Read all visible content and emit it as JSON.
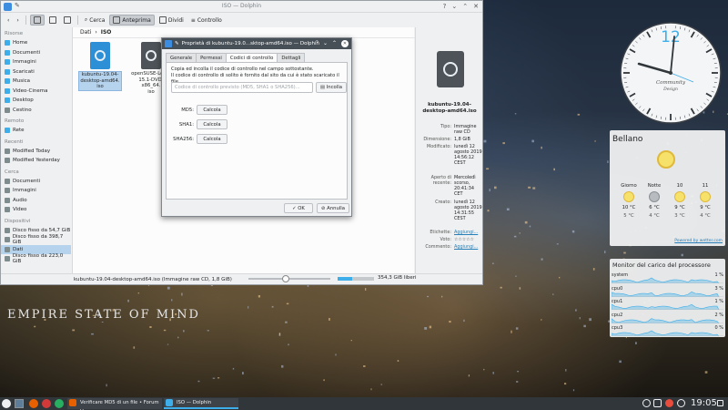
{
  "colors": {
    "accent": "#3daee9",
    "selection": "#b6d3ee",
    "panel": "#31363b",
    "window": "#eff0f1",
    "dialog_title": "#475057"
  },
  "wallpaper": {
    "text": "EMPIRE STATE OF MIND"
  },
  "dolphin": {
    "window_title": "ISO — Dolphin",
    "toolbar": {
      "search": "Cerca",
      "preview": "Anteprima",
      "split": "Dividi",
      "control": "Controllo"
    },
    "places": {
      "sections": [
        {
          "title": "Risorse",
          "items": [
            {
              "label": "Home",
              "icon": "home-icon",
              "color": "#3daee9"
            },
            {
              "label": "Documenti",
              "icon": "folder-documents-icon",
              "color": "#3daee9"
            },
            {
              "label": "Immagini",
              "icon": "folder-pictures-icon",
              "color": "#3daee9"
            },
            {
              "label": "Scaricati",
              "icon": "folder-download-icon",
              "color": "#3daee9"
            },
            {
              "label": "Musica",
              "icon": "folder-music-icon",
              "color": "#3daee9"
            },
            {
              "label": "Video-Cinema",
              "icon": "folder-videos-icon",
              "color": "#3daee9"
            },
            {
              "label": "Desktop",
              "icon": "desktop-icon",
              "color": "#3daee9"
            },
            {
              "label": "Cestino",
              "icon": "trash-icon",
              "color": "#7f8c8d"
            }
          ]
        },
        {
          "title": "Remoto",
          "items": [
            {
              "label": "Rete",
              "icon": "network-icon",
              "color": "#3daee9"
            }
          ]
        },
        {
          "title": "Recenti",
          "items": [
            {
              "label": "Modified Today",
              "icon": "calendar-icon",
              "color": "#7f8c8d"
            },
            {
              "label": "Modified Yesterday",
              "icon": "calendar-icon",
              "color": "#7f8c8d"
            }
          ]
        },
        {
          "title": "Cerca",
          "items": [
            {
              "label": "Documenti",
              "icon": "search-documents-icon",
              "color": "#7f8c8d"
            },
            {
              "label": "Immagini",
              "icon": "search-images-icon",
              "color": "#7f8c8d"
            },
            {
              "label": "Audio",
              "icon": "search-audio-icon",
              "color": "#7f8c8d"
            },
            {
              "label": "Video",
              "icon": "search-video-icon",
              "color": "#7f8c8d"
            }
          ]
        },
        {
          "title": "Dispositivi",
          "items": [
            {
              "label": "Disco fisso da 54,7 GiB",
              "icon": "drive-icon",
              "color": "#7f8c8d"
            },
            {
              "label": "Disco fisso da 398,7 GiB",
              "icon": "drive-icon",
              "color": "#7f8c8d"
            },
            {
              "label": "Dati",
              "icon": "drive-icon",
              "color": "#7f8c8d",
              "selected": true
            },
            {
              "label": "Disco fisso da 223,0 GiB",
              "icon": "drive-icon",
              "color": "#7f8c8d"
            }
          ]
        }
      ]
    },
    "breadcrumb": {
      "parent": "Dati",
      "separator": "›",
      "current": "ISO"
    },
    "files": [
      {
        "name": "kubuntu-19.04-desktop-amd64.iso",
        "lines": [
          "kubuntu-19.04-",
          "desktop-amd64.",
          "iso"
        ],
        "color": "#2d8fd5",
        "selected": true
      },
      {
        "name": "openSUSE-Leap-15.1-DVD-x86_64.iso",
        "lines": [
          "openSUSE-Leap-",
          "15.1-DVD-x86_64.",
          "iso"
        ],
        "color": "#4d5358",
        "selected": false
      }
    ],
    "info": {
      "name": "kubuntu-19.04-desktop-amd64.iso",
      "rows": [
        {
          "k": "Tipo:",
          "v": "Immagine raw CD"
        },
        {
          "k": "Dimensione:",
          "v": "1,8 GiB"
        },
        {
          "k": "Modificato:",
          "v": "lunedì 12 agosto 2019 14:56:12 CEST"
        },
        {
          "k": "Aperto di recente:",
          "v": "Mercoledì scorso, 20:41:34 CET"
        },
        {
          "k": "Creato:",
          "v": "lunedì 12 agosto 2019 14:31:55 CEST"
        },
        {
          "k": "Etichette:",
          "v": "Aggiungi...",
          "link": true
        },
        {
          "k": "Voto:",
          "v": "☆☆☆☆☆"
        },
        {
          "k": "Commento:",
          "v": "Aggiungi...",
          "link": true
        }
      ]
    },
    "status_text": "kubuntu-19.04-desktop-amd64.iso (Immagine raw CD, 1,8 GiB)",
    "free_space": "354,3 GiB liberi",
    "free_space_used_fraction": 0.4,
    "zoom_level": 0.45
  },
  "dialog": {
    "title": "Proprietà di kubuntu-19.0...sktop-amd64.iso — Dolphin",
    "tabs": [
      "Generale",
      "Permessi",
      "Codici di controllo",
      "Dettagli"
    ],
    "active_tab": 2,
    "description_1": "Copia ed incolla il codice di controllo nel campo sottostante.",
    "description_2": "Il codice di controllo di solito è fornito dal sito da cui è stato scaricato il file.",
    "input_placeholder": "Codice di controllo previsto (MD5, SHA1 o SHA256)...",
    "paste_label": "Incolla",
    "hashes": [
      {
        "label": "MD5:",
        "button": "Calcola"
      },
      {
        "label": "SHA1:",
        "button": "Calcola"
      },
      {
        "label": "SHA256:",
        "button": "Calcola"
      }
    ],
    "ok_label": "OK",
    "cancel_label": "Annulla"
  },
  "clock_widget": {
    "number": "12",
    "brand_1": "Community",
    "brand_2": "Design"
  },
  "weather": {
    "city": "Bellano",
    "days": [
      {
        "name": "Giorno",
        "icon": "sun-icon",
        "hi": "10 °C",
        "lo": "5 °C"
      },
      {
        "name": "Notte",
        "icon": "moon-icon",
        "hi": "6 °C",
        "lo": "4 °C"
      },
      {
        "name": "10",
        "icon": "sun-icon",
        "hi": "9 °C",
        "lo": "3 °C"
      },
      {
        "name": "11",
        "icon": "sun-icon",
        "hi": "9 °C",
        "lo": "4 °C"
      }
    ],
    "powered": "Powered by wetter.com"
  },
  "sysmon": {
    "title": "Monitor del carico del processore",
    "rows": [
      {
        "name": "system",
        "pct": "1 %"
      },
      {
        "name": "cpu0",
        "pct": "3 %"
      },
      {
        "name": "cpu1",
        "pct": "1 %"
      },
      {
        "name": "cpu2",
        "pct": "2 %"
      },
      {
        "name": "cpu3",
        "pct": "0 %"
      }
    ]
  },
  "taskbar": {
    "tasks": [
      {
        "label": "Verificare MD5 di un file • Forum U...",
        "icon": "firefox-icon",
        "color": "#e66000",
        "active": false
      },
      {
        "label": "ISO — Dolphin",
        "icon": "dolphin-icon",
        "color": "#3daee9",
        "active": true
      }
    ],
    "time": "19:05"
  }
}
